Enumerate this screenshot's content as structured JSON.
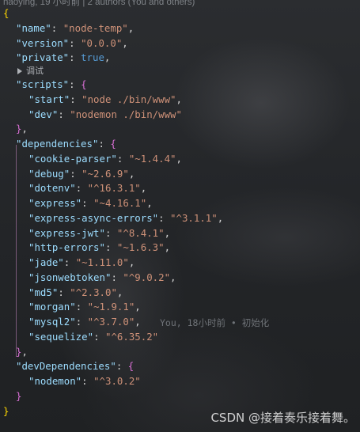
{
  "blame_header": "haoying, 19 小时前 | 2 authors (You and others)",
  "codelens_label": "调试",
  "inline_blame": "You, 18小时前 • 初始化",
  "watermark": "CSDN @接着奏乐接着舞。",
  "colors": {
    "background": "#242628",
    "key": "#9cdcfe",
    "string": "#ce9178",
    "boolean": "#569cd6",
    "brace_level1": "#ffd700",
    "brace_level2": "#da70d6"
  },
  "package": {
    "name_key": "\"name\"",
    "name_val": "\"node-temp\"",
    "version_key": "\"version\"",
    "version_val": "\"0.0.0\"",
    "private_key": "\"private\"",
    "private_val": "true",
    "scripts_key": "\"scripts\"",
    "scripts": [
      {
        "key": "\"start\"",
        "val": "\"node ./bin/www\""
      },
      {
        "key": "\"dev\"",
        "val": "\"nodemon ./bin/www\""
      }
    ],
    "dependencies_key": "\"dependencies\"",
    "dependencies": [
      {
        "key": "\"cookie-parser\"",
        "val": "\"~1.4.4\""
      },
      {
        "key": "\"debug\"",
        "val": "\"~2.6.9\""
      },
      {
        "key": "\"dotenv\"",
        "val": "\"^16.3.1\""
      },
      {
        "key": "\"express\"",
        "val": "\"~4.16.1\""
      },
      {
        "key": "\"express-async-errors\"",
        "val": "\"^3.1.1\""
      },
      {
        "key": "\"express-jwt\"",
        "val": "\"^8.4.1\""
      },
      {
        "key": "\"http-errors\"",
        "val": "\"~1.6.3\""
      },
      {
        "key": "\"jade\"",
        "val": "\"~1.11.0\""
      },
      {
        "key": "\"jsonwebtoken\"",
        "val": "\"^9.0.2\""
      },
      {
        "key": "\"md5\"",
        "val": "\"^2.3.0\""
      },
      {
        "key": "\"morgan\"",
        "val": "\"~1.9.1\""
      },
      {
        "key": "\"mysql2\"",
        "val": "\"^3.7.0\""
      },
      {
        "key": "\"sequelize\"",
        "val": "\"^6.35.2\""
      }
    ],
    "devDependencies_key": "\"devDependencies\"",
    "devDependencies": [
      {
        "key": "\"nodemon\"",
        "val": "\"^3.0.2\""
      }
    ]
  }
}
